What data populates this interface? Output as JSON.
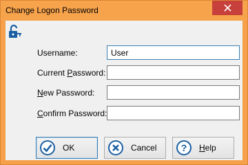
{
  "window": {
    "title": "Change Logon Password"
  },
  "form": {
    "username_label": "Username:",
    "username_value": "User",
    "current_password_label_pre": "Current ",
    "current_password_label_key": "P",
    "current_password_label_post": "assword:",
    "new_password_label_key": "N",
    "new_password_label_post": "ew Password:",
    "confirm_password_label_key": "C",
    "confirm_password_label_post": "onfirm Password:",
    "current_password_value": "",
    "new_password_value": "",
    "confirm_password_value": ""
  },
  "buttons": {
    "ok_label": "OK",
    "cancel_label": "Cancel",
    "help_label_key": "H",
    "help_label_post": "elp"
  },
  "icons": {
    "title_close": "close-icon",
    "lock": "lock-icon",
    "ok": "checkmark-icon",
    "cancel": "x-icon",
    "help": "question-icon"
  },
  "colors": {
    "titlebar": "#f7a34c",
    "close_button": "#c7403b",
    "client_background": "#f0f0f0",
    "icon_blue": "#1a5fa3"
  }
}
